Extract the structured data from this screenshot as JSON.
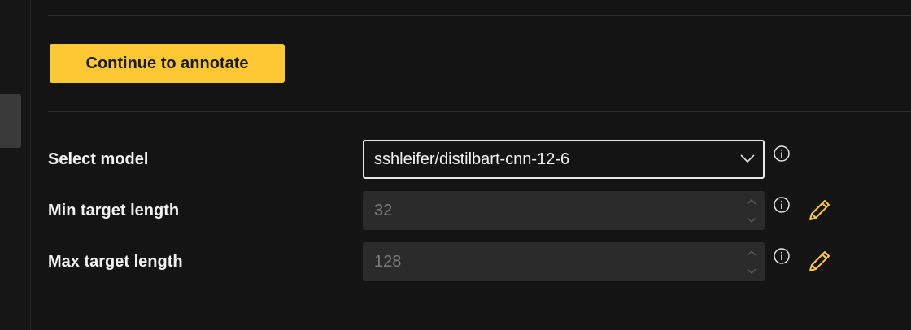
{
  "actions": {
    "continue_label": "Continue to annotate"
  },
  "settings": {
    "select_model": {
      "label": "Select model",
      "value": "sshleifer/distilbart-cnn-12-6"
    },
    "min_target_length": {
      "label": "Min target length",
      "value": "32"
    },
    "max_target_length": {
      "label": "Max target length",
      "value": "128"
    }
  },
  "icons": {
    "info": "info-circle-icon",
    "edit": "pencil-icon",
    "dropdown": "chevron-down-icon"
  },
  "colors": {
    "background": "#141414",
    "accent": "#fdc834",
    "text": "#f2f2f2",
    "disabled_input": "#2b2b2b",
    "disabled_text": "#7c7c7c"
  }
}
